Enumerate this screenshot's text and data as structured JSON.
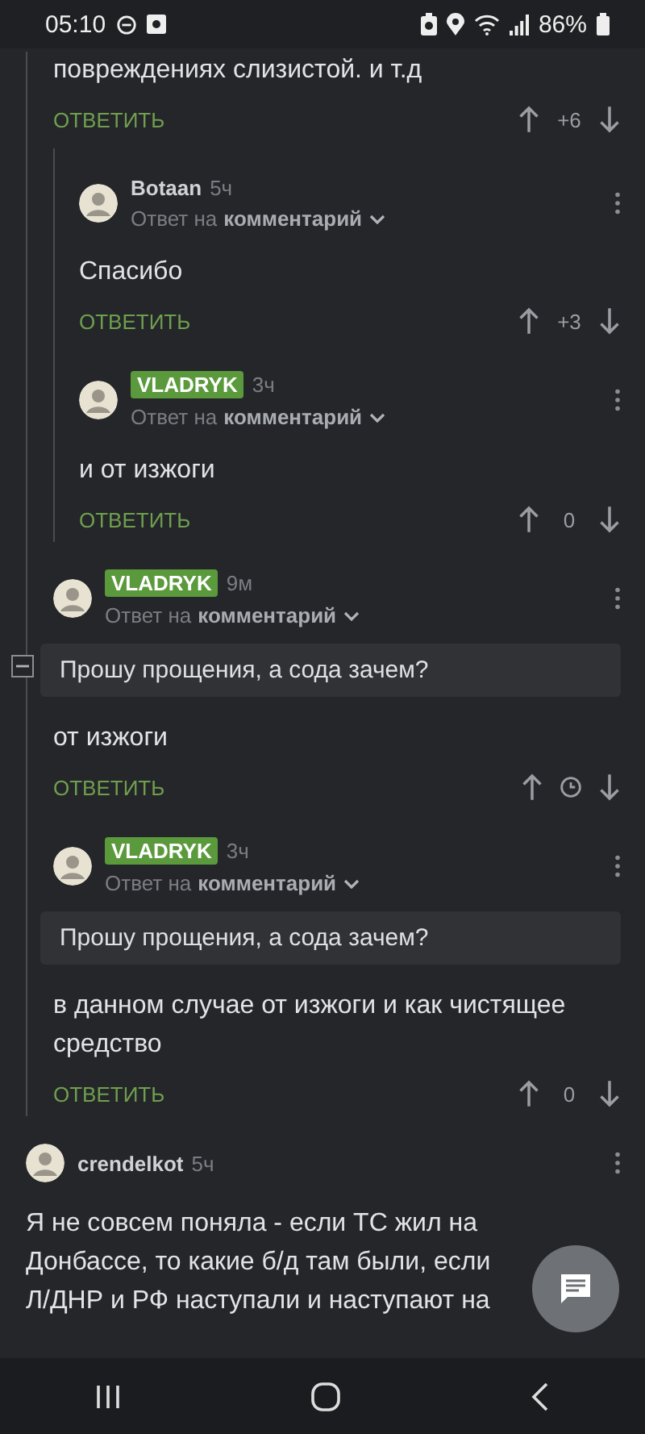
{
  "status_bar": {
    "time": "05:10",
    "battery": "86%"
  },
  "comments": [
    {
      "kind": "continued",
      "children": [
        {
          "kind": "fragment",
          "body": "повреждениях слизистой. и т.д",
          "reply_label": "ОТВЕТИТЬ",
          "rating": "+6",
          "children": [
            {
              "kind": "comment",
              "author": "Botaan",
              "badge": false,
              "time": "5ч",
              "reply_prefix": "Ответ на",
              "reply_target": "комментарий",
              "body": "Спасибо",
              "reply_label": "ОТВЕТИТЬ",
              "rating": "+3"
            },
            {
              "kind": "comment",
              "author": "VLADRYK",
              "badge": true,
              "time": "3ч",
              "reply_prefix": "Ответ на",
              "reply_target": "комментарий",
              "body": "и от изжоги",
              "reply_label": "ОТВЕТИТЬ",
              "rating": "0"
            }
          ]
        },
        {
          "kind": "comment",
          "author": "VLADRYK",
          "badge": true,
          "time": "9м",
          "collapse": true,
          "reply_prefix": "Ответ на",
          "reply_target": "комментарий",
          "quote": "Прошу прощения, а сода зачем?",
          "body": "от изжоги",
          "reply_label": "ОТВЕТИТЬ",
          "rating_pending": true
        },
        {
          "kind": "comment",
          "author": "VLADRYK",
          "badge": true,
          "time": "3ч",
          "reply_prefix": "Ответ на",
          "reply_target": "комментарий",
          "quote": "Прошу прощения, а сода зачем?",
          "body": "в данном случае от изжоги и как чистящее средство",
          "reply_label": "ОТВЕТИТЬ",
          "rating": "0"
        }
      ]
    },
    {
      "kind": "comment",
      "author": "crendelkot",
      "badge": false,
      "time": "5ч",
      "body": "Я не совсем поняла - если ТС жил на Донбассе, то какие б/д там были, если Л/ДНР и РФ наступали и наступают на"
    }
  ]
}
